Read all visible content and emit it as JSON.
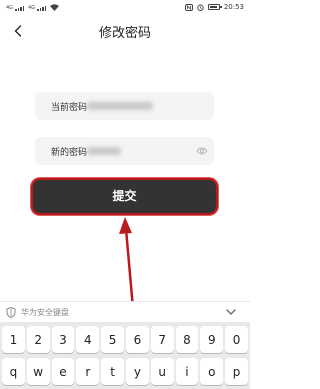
{
  "status_bar": {
    "sim1": "4G",
    "sim2": "4G",
    "time": "20:53"
  },
  "nav": {
    "title": "修改密码"
  },
  "form": {
    "current_label": "当前密码",
    "new_label": "新的密码"
  },
  "submit_label": "提交",
  "keyboard": {
    "header_label": "华为安全键盘",
    "row1": [
      "1",
      "2",
      "3",
      "4",
      "5",
      "6",
      "7",
      "8",
      "9",
      "0"
    ],
    "row2": [
      "q",
      "w",
      "e",
      "r",
      "t",
      "y",
      "u",
      "i",
      "o",
      "p"
    ]
  },
  "colors": {
    "button": "#333333",
    "annotation": "#bb1a1a"
  }
}
